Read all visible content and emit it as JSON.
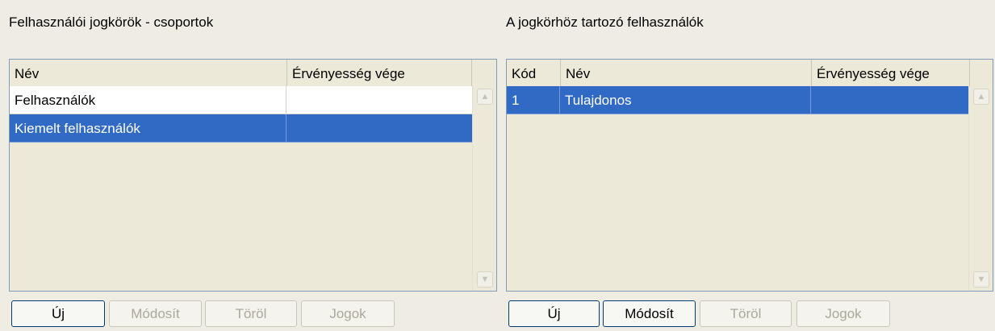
{
  "left_panel": {
    "title": "Felhasználói jogkörök - csoportok",
    "columns": [
      "Név",
      "Érvényesség vége"
    ],
    "rows": [
      {
        "name": "Felhasználók",
        "expiry": "",
        "selected": false
      },
      {
        "name": "Kiemelt felhasználók",
        "expiry": "",
        "selected": true
      }
    ],
    "buttons": {
      "new": {
        "label": "Új",
        "enabled": true
      },
      "modify": {
        "label": "Módosít",
        "enabled": false
      },
      "delete": {
        "label": "Töröl",
        "enabled": false
      },
      "rights": {
        "label": "Jogok",
        "enabled": false
      }
    }
  },
  "right_panel": {
    "title": "A jogkörhöz tartozó felhasználók",
    "columns": [
      "Kód",
      "Név",
      "Érvényesség vége"
    ],
    "rows": [
      {
        "code": "1",
        "name": "Tulajdonos",
        "expiry": "",
        "selected": true
      }
    ],
    "buttons": {
      "new": {
        "label": "Új",
        "enabled": true
      },
      "modify": {
        "label": "Módosít",
        "enabled": true
      },
      "delete": {
        "label": "Töröl",
        "enabled": false
      },
      "rights": {
        "label": "Jogok",
        "enabled": false
      }
    }
  },
  "icons": {
    "scroll_up": "scroll-up-arrow-icon",
    "scroll_down": "scroll-down-arrow-icon"
  },
  "colors": {
    "background": "#efede3",
    "selection": "#316ac5",
    "grid_border": "#7f9db9"
  }
}
